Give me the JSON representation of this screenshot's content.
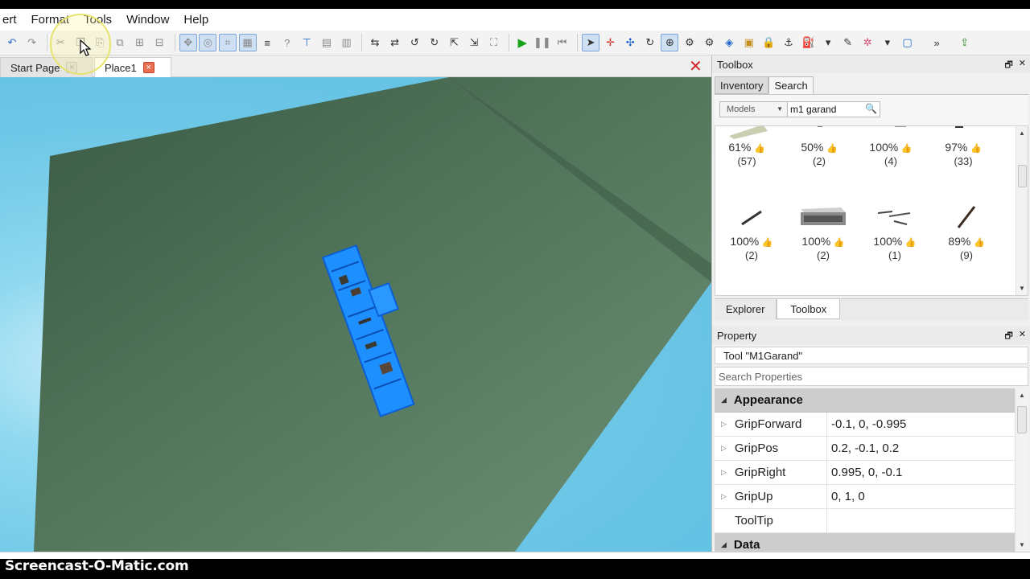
{
  "menu": {
    "items": [
      "ert",
      "Format",
      "Tools",
      "Window",
      "Help"
    ]
  },
  "toolbar": {
    "groups": [
      [
        "undo-icon",
        "redo-icon",
        "cut-icon",
        "copy-icon",
        "paste-icon",
        "duplicate-icon",
        "group-icon",
        "ungroup-icon"
      ],
      [
        "select-icon",
        "move-icon",
        "resize-icon",
        "rotate-icon"
      ],
      [
        "run-icon",
        "pause-icon",
        "reset-icon"
      ]
    ]
  },
  "tabs": {
    "start_page": "Start Page",
    "place1": "Place1"
  },
  "toolbox": {
    "title": "Toolbox",
    "tabs": [
      "Inventory",
      "Search"
    ],
    "category": "Models",
    "search_value": "m1 garand",
    "items": [
      {
        "pct": "61%",
        "count": "(57)"
      },
      {
        "pct": "50%",
        "count": "(2)"
      },
      {
        "pct": "100%",
        "count": "(4)"
      },
      {
        "pct": "97%",
        "count": "(33)"
      },
      {
        "pct": "100%",
        "count": "(2)"
      },
      {
        "pct": "100%",
        "count": "(2)"
      },
      {
        "pct": "100%",
        "count": "(1)"
      },
      {
        "pct": "89%",
        "count": "(9)"
      }
    ],
    "bottom_tabs": [
      "Explorer",
      "Toolbox"
    ]
  },
  "property": {
    "title": "Property",
    "object": "Tool \"M1Garand\"",
    "search_placeholder": "Search Properties",
    "category_appearance": "Appearance",
    "rows": [
      {
        "name": "GripForward",
        "value": "-0.1, 0, -0.995"
      },
      {
        "name": "GripPos",
        "value": "0.2, -0.1, 0.2"
      },
      {
        "name": "GripRight",
        "value": "0.995, 0, -0.1"
      },
      {
        "name": "GripUp",
        "value": "0, 1, 0"
      },
      {
        "name": "ToolTip",
        "value": ""
      }
    ],
    "category_data": "Data"
  },
  "watermark": "Screencast-O-Matic.com",
  "colors": {
    "sky": "#6cc6e6",
    "baseplate": "#4a6b52",
    "selection": "#1e90ff",
    "play_green": "#1aa31a",
    "close_red": "#d1242a"
  }
}
